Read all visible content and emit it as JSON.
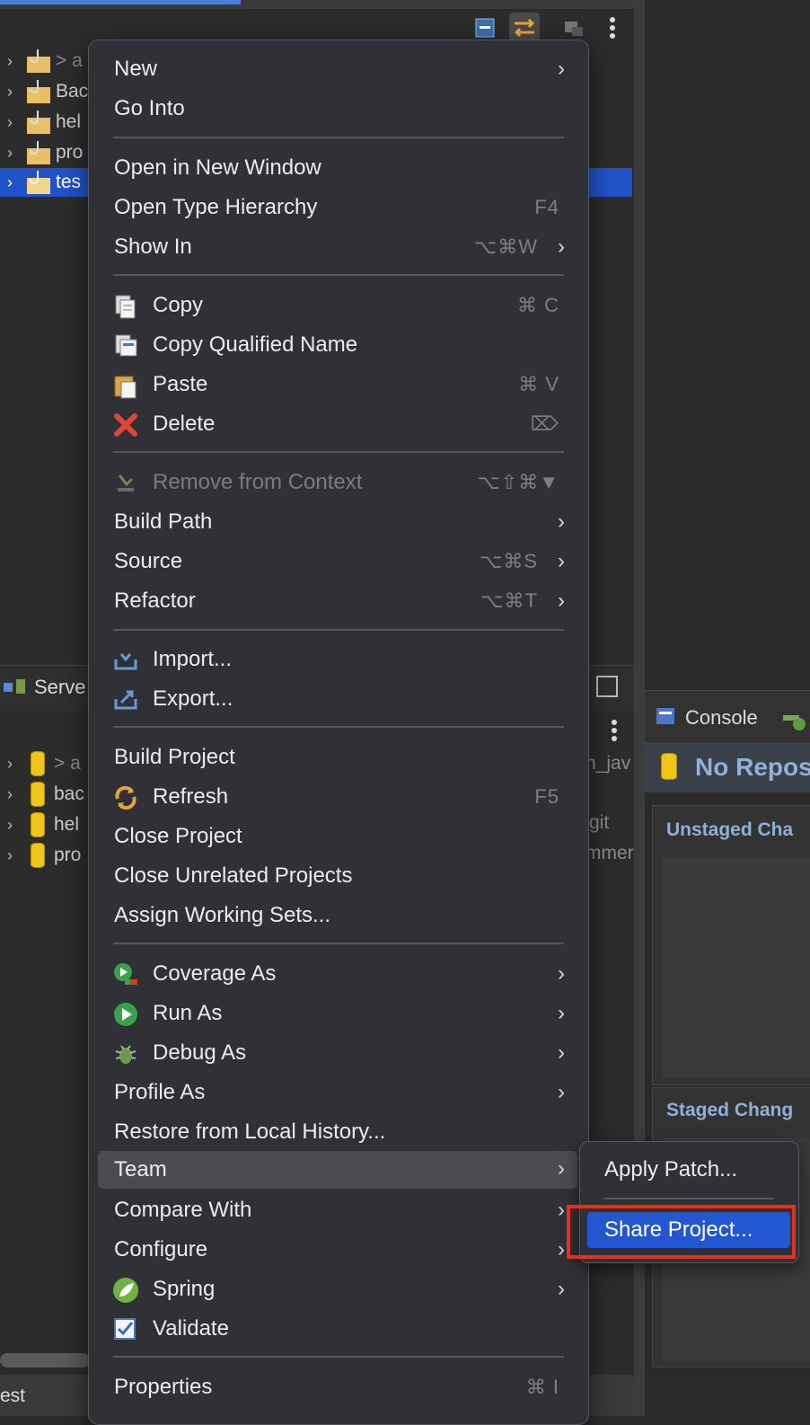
{
  "explorer": {
    "tree_labels": [
      "> a",
      "Bac",
      "hel",
      "pro",
      "tes"
    ],
    "servers_tab": "Serve",
    "servers_items": [
      "> a",
      "bac",
      "hel",
      "pro"
    ],
    "behind_text": [
      "n_jav",
      "git",
      "mmer"
    ],
    "status_text": "est"
  },
  "git_staging": {
    "console_tab": "Console",
    "no_repo": "No Repos",
    "unstaged": "Unstaged Cha",
    "staged": "Staged Chang"
  },
  "menu": {
    "items": [
      {
        "label": "New",
        "shortcut": "",
        "submenu": true
      },
      {
        "label": "Go Into",
        "shortcut": ""
      },
      {
        "label": "Open in New Window",
        "shortcut": ""
      },
      {
        "label": "Open Type Hierarchy",
        "shortcut": "F4"
      },
      {
        "label": "Show In",
        "shortcut": "⌥⌘W",
        "submenu": true
      },
      {
        "label": "Copy",
        "shortcut": "⌘ C",
        "icon": "copy-icon"
      },
      {
        "label": "Copy Qualified Name",
        "shortcut": "",
        "icon": "copy-qualified-name-icon"
      },
      {
        "label": "Paste",
        "shortcut": "⌘ V",
        "icon": "paste-icon"
      },
      {
        "label": "Delete",
        "shortcut": "⌦",
        "icon": "delete-icon"
      },
      {
        "label": "Remove from Context",
        "shortcut": "⌥⇧⌘▼",
        "icon": "remove-context-icon",
        "disabled": true
      },
      {
        "label": "Build Path",
        "shortcut": "",
        "submenu": true
      },
      {
        "label": "Source",
        "shortcut": "⌥⌘S",
        "submenu": true
      },
      {
        "label": "Refactor",
        "shortcut": "⌥⌘T",
        "submenu": true
      },
      {
        "label": "Import...",
        "shortcut": "",
        "icon": "import-icon"
      },
      {
        "label": "Export...",
        "shortcut": "",
        "icon": "export-icon"
      },
      {
        "label": "Build Project",
        "shortcut": ""
      },
      {
        "label": "Refresh",
        "shortcut": "F5",
        "icon": "refresh-icon"
      },
      {
        "label": "Close Project",
        "shortcut": ""
      },
      {
        "label": "Close Unrelated Projects",
        "shortcut": ""
      },
      {
        "label": "Assign Working Sets...",
        "shortcut": ""
      },
      {
        "label": "Coverage As",
        "shortcut": "",
        "icon": "coverage-icon",
        "submenu": true
      },
      {
        "label": "Run As",
        "shortcut": "",
        "icon": "run-icon",
        "submenu": true
      },
      {
        "label": "Debug As",
        "shortcut": "",
        "icon": "debug-icon",
        "submenu": true
      },
      {
        "label": "Profile As",
        "shortcut": "",
        "submenu": true
      },
      {
        "label": "Restore from Local History...",
        "shortcut": ""
      },
      {
        "label": "Team",
        "shortcut": "",
        "submenu": true,
        "highlighted": true
      },
      {
        "label": "Compare With",
        "shortcut": "",
        "submenu": true
      },
      {
        "label": "Configure",
        "shortcut": "",
        "submenu": true
      },
      {
        "label": "Spring",
        "shortcut": "",
        "icon": "spring-icon",
        "submenu": true
      },
      {
        "label": "Validate",
        "shortcut": "",
        "icon": "validate-icon"
      },
      {
        "label": "Properties",
        "shortcut": "⌘ I"
      }
    ]
  },
  "team_submenu": {
    "apply_patch": "Apply Patch...",
    "share_project": "Share Project..."
  },
  "colors": {
    "selection": "#2356d1",
    "annotation": "#e0321c"
  }
}
